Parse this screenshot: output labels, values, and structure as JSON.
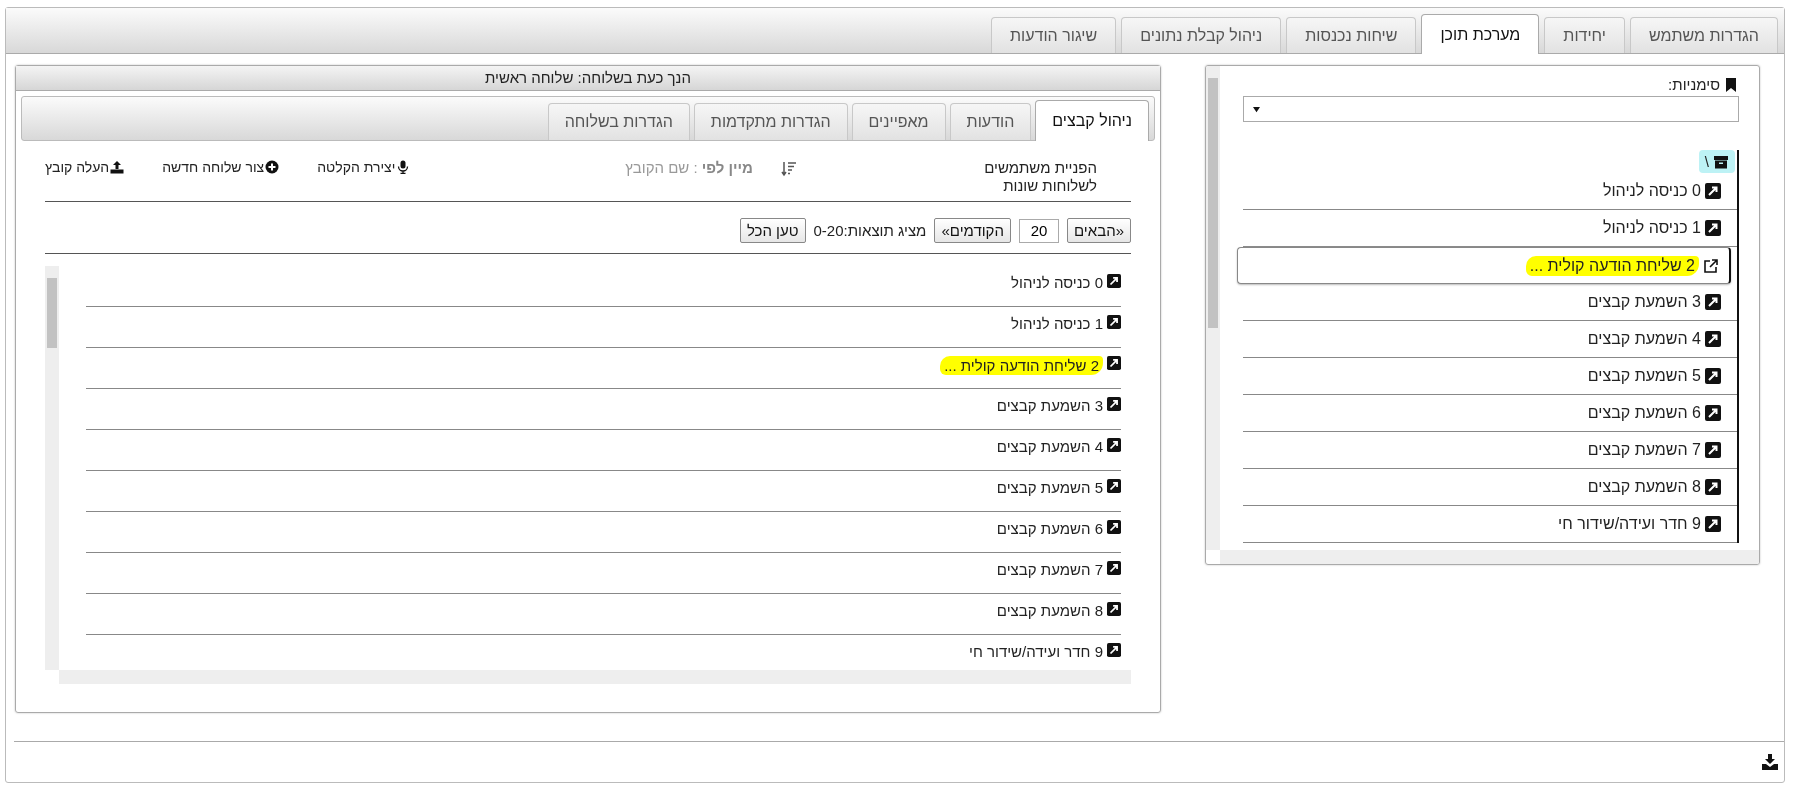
{
  "top_tabs": [
    {
      "label": "הגדרות משתמש",
      "selected": false
    },
    {
      "label": "יחידות",
      "selected": false
    },
    {
      "label": "מערכת תוכן",
      "selected": true
    },
    {
      "label": "שיחות נכנסות",
      "selected": false
    },
    {
      "label": "ניהול קבלת נתונים",
      "selected": false
    },
    {
      "label": "שיגור הודעות",
      "selected": false
    }
  ],
  "bookmarks": {
    "label": "סימניות:"
  },
  "tree": {
    "root": "\\",
    "items": [
      {
        "label": "0 כניסה לניהול",
        "selected": false,
        "highlighted": false
      },
      {
        "label": "1 כניסה לניהול",
        "selected": false,
        "highlighted": false
      },
      {
        "label": "2 שליחת הודעה קולית ...",
        "selected": true,
        "highlighted": true
      },
      {
        "label": "3 השמעת קבצים",
        "selected": false,
        "highlighted": false
      },
      {
        "label": "4 השמעת קבצים",
        "selected": false,
        "highlighted": false
      },
      {
        "label": "5 השמעת קבצים",
        "selected": false,
        "highlighted": false
      },
      {
        "label": "6 השמעת קבצים",
        "selected": false,
        "highlighted": false
      },
      {
        "label": "7 השמעת קבצים",
        "selected": false,
        "highlighted": false
      },
      {
        "label": "8 השמעת קבצים",
        "selected": false,
        "highlighted": false
      },
      {
        "label": "9 חדר ועידה/שידור חי",
        "selected": false,
        "highlighted": false
      }
    ]
  },
  "extension_panel": {
    "title": "הנך כעת בשלוחה: שלוחה ראשית",
    "tabs": [
      {
        "label": "ניהול קבצים",
        "selected": true
      },
      {
        "label": "הודעות",
        "selected": false
      },
      {
        "label": "מאפיינים",
        "selected": false
      },
      {
        "label": "הגדרות מתקדמות",
        "selected": false
      },
      {
        "label": "הגדרות בשלוחה",
        "selected": false
      }
    ],
    "redirect_label": "הפניית משתמשים לשלוחות שונות",
    "sort": "**מיין לפי** : שם הקובץ",
    "actions": [
      {
        "label": "יצירת הקלטה",
        "kind": "record"
      },
      {
        "label": "צור שלוחה חדשה",
        "kind": "create"
      },
      {
        "label": "העלה קובץ",
        "kind": "upload"
      }
    ],
    "pagination": {
      "next": "«הבאים",
      "page_size": "20",
      "previous": "הקודמים»",
      "results": "מציג תוצאות:0-20",
      "load_all": "טען הכל"
    },
    "files": [
      {
        "label": "0 כניסה לניהול",
        "highlighted": false
      },
      {
        "label": "1 כניסה לניהול",
        "highlighted": false
      },
      {
        "label": "2 שליחת הודעה קולית ...",
        "highlighted": true
      },
      {
        "label": "3 השמעת קבצים",
        "highlighted": false
      },
      {
        "label": "4 השמעת קבצים",
        "highlighted": false
      },
      {
        "label": "5 השמעת קבצים",
        "highlighted": false
      },
      {
        "label": "6 השמעת קבצים",
        "highlighted": false
      },
      {
        "label": "7 השמעת קבצים",
        "highlighted": false
      },
      {
        "label": "8 השמעת קבצים",
        "highlighted": false
      },
      {
        "label": "9 חדר ועידה/שידור חי",
        "highlighted": false
      }
    ]
  }
}
